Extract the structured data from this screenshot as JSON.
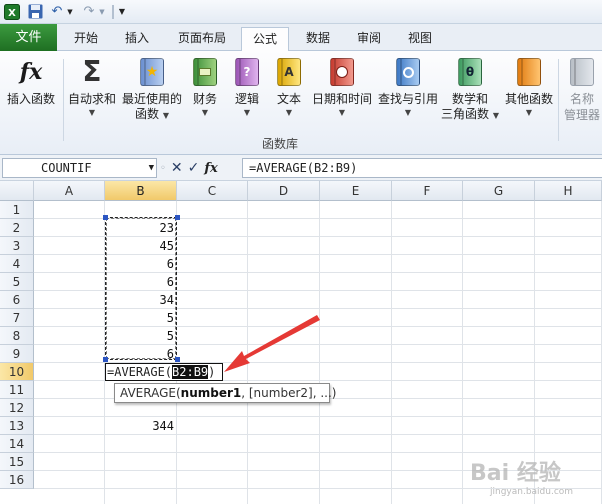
{
  "quick_access": {
    "excel_icon": "excel-icon",
    "save_icon": "save-icon",
    "undo_icon": "undo-icon",
    "redo_icon": "redo-icon",
    "customize_icon": "customize-icon",
    "accent": "#1e6f22"
  },
  "tabs": [
    "文件",
    "开始",
    "插入",
    "页面布局",
    "公式",
    "数据",
    "审阅",
    "视图"
  ],
  "active_tab": "公式",
  "ribbon": {
    "insert_function": "插入函数",
    "autosum": "自动求和",
    "recent_line1": "最近使用的",
    "recent_line2": "函数",
    "finance": "财务",
    "logic": "逻辑",
    "text": "文本",
    "datetime": "日期和时间",
    "lookup": "查找与引用",
    "math_line1": "数学和",
    "math_line2": "三角函数",
    "other": "其他函数",
    "name_line1": "名称",
    "name_line2": "管理器",
    "group_label": "函数库",
    "fx_glyph": "fx",
    "sigma_glyph": "Σ",
    "logic_glyph": "?",
    "text_glyph": "A",
    "math_glyph": "θ"
  },
  "formula_bar": {
    "name_box": "COUNTIF",
    "cancel_glyph": "✕",
    "confirm_glyph": "✓",
    "fx_glyph": "fx",
    "formula": "=AVERAGE(B2:B9)"
  },
  "sheet": {
    "columns": [
      "A",
      "B",
      "C",
      "D",
      "E",
      "F",
      "G",
      "H"
    ],
    "rows": [
      "1",
      "2",
      "3",
      "4",
      "5",
      "6",
      "7",
      "8",
      "9",
      "10",
      "11",
      "12",
      "13",
      "14",
      "15",
      "16"
    ],
    "b_values": [
      "23",
      "45",
      "6",
      "6",
      "34",
      "5",
      "5",
      "6"
    ],
    "b13": "344",
    "edit_prefix": "=AVERAGE(",
    "edit_ref": "B2:B9",
    "edit_suffix": ")",
    "tooltip_func": "AVERAGE(",
    "tooltip_arg1": "number1",
    "tooltip_rest": ", [number2], ...)"
  },
  "watermark": {
    "text": "Bai 经验",
    "sub": "jingyan.baidu.com"
  },
  "colors": {
    "selection_header": "#f1c96a",
    "arrow": "#e53935",
    "file_tab": "#2e8b32"
  }
}
